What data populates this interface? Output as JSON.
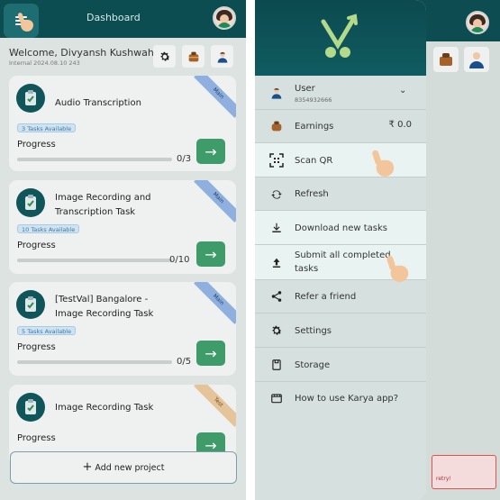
{
  "left": {
    "header": {
      "title": "Dashboard"
    },
    "welcome": "Welcome, Divyansh Kushwaha",
    "internal": "Internal 2024.08.10 243",
    "cards": [
      {
        "title": "Audio Transcription",
        "title2": "",
        "badge": "3 Tasks Available",
        "progress_label": "Progress",
        "count": "0/3",
        "ribbon": "Main",
        "progress": 0
      },
      {
        "title": "Image Recording and",
        "title2": "Transcription  Task",
        "badge": "10 Tasks Available",
        "progress_label": "Progress",
        "count": "0/10",
        "ribbon": "Main",
        "progress": 0
      },
      {
        "title": "[TestVal] Bangalore -",
        "title2": "Image Recording Task",
        "badge": "5 Tasks Available",
        "progress_label": "Progress",
        "count": "0/5",
        "ribbon": "Main",
        "progress": 0
      },
      {
        "title": "Image Recording Task",
        "title2": "",
        "badge": "",
        "progress_label": "Progress",
        "count": "",
        "ribbon": "Test",
        "progress": 0
      }
    ],
    "add_project": "Add new project"
  },
  "right": {
    "user": {
      "label": "User",
      "phone": "8354932666"
    },
    "menu": [
      {
        "label": "Earnings",
        "label2": "",
        "value": "₹ 0.0",
        "icon": "money-bag-icon"
      },
      {
        "label": "Scan QR",
        "label2": "",
        "value": "",
        "icon": "qr-scan-icon"
      },
      {
        "label": "Refresh",
        "label2": "",
        "value": "",
        "icon": "refresh-icon"
      },
      {
        "label": "Download new tasks",
        "label2": "",
        "value": "",
        "icon": "download-icon"
      },
      {
        "label": "Submit all completed",
        "label2": "tasks",
        "value": "",
        "icon": "upload-icon"
      },
      {
        "label": "Refer a friend",
        "label2": "",
        "value": "",
        "icon": "share-icon"
      },
      {
        "label": "Settings",
        "label2": "",
        "value": "",
        "icon": "gear-icon"
      },
      {
        "label": "Storage",
        "label2": "",
        "value": "",
        "icon": "storage-icon"
      },
      {
        "label": "How to use Karya app?",
        "label2": "",
        "value": "",
        "icon": "video-icon"
      }
    ],
    "error_text": "retry!"
  },
  "colors": {
    "teal": "#0c4d52",
    "green": "#3f9b6a",
    "ribbon_main": "#8fb0de",
    "ribbon_test": "#e6c49a"
  }
}
